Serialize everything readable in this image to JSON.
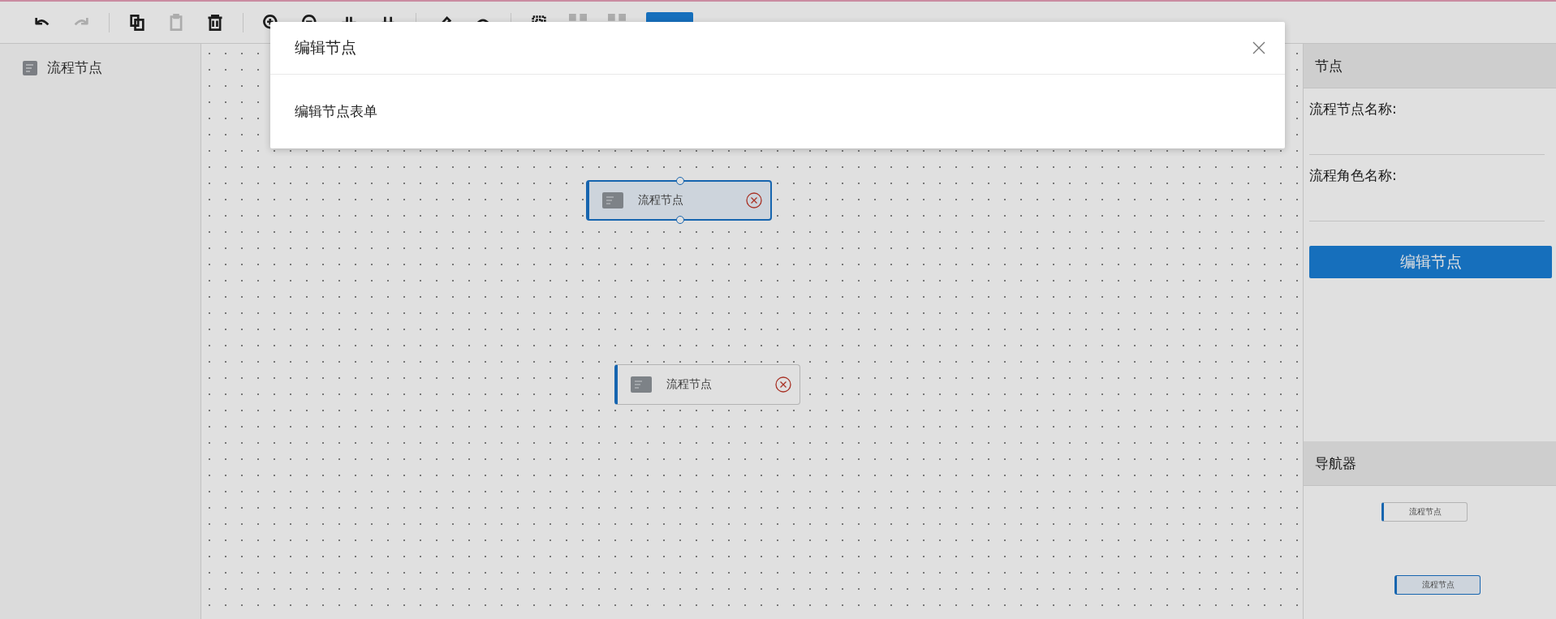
{
  "toolbar": {
    "items": [
      {
        "kind": "undo",
        "disabled": false
      },
      {
        "kind": "redo",
        "disabled": true
      },
      {
        "kind": "divider"
      },
      {
        "kind": "copy",
        "disabled": false
      },
      {
        "kind": "paste",
        "disabled": true
      },
      {
        "kind": "delete",
        "disabled": false
      },
      {
        "kind": "divider"
      },
      {
        "kind": "zoom-in",
        "disabled": false
      },
      {
        "kind": "zoom-out",
        "disabled": false
      },
      {
        "kind": "fit",
        "disabled": false
      },
      {
        "kind": "actual",
        "disabled": false
      },
      {
        "kind": "divider"
      },
      {
        "kind": "front",
        "disabled": false
      },
      {
        "kind": "back",
        "disabled": false
      },
      {
        "kind": "divider"
      },
      {
        "kind": "select",
        "disabled": false
      },
      {
        "kind": "group",
        "disabled": true
      },
      {
        "kind": "ungroup",
        "disabled": true
      }
    ]
  },
  "palette": {
    "items": [
      {
        "label": "流程节点"
      }
    ]
  },
  "canvas": {
    "nodes": [
      {
        "label": "流程节点",
        "selected": true
      },
      {
        "label": "流程节点",
        "selected": false
      }
    ]
  },
  "panel": {
    "title": "节点",
    "fields": [
      {
        "label": "流程节点名称:"
      },
      {
        "label": "流程角色名称:"
      }
    ],
    "button": "编辑节点"
  },
  "navigator": {
    "title": "导航器",
    "nodes": [
      {
        "label": "流程节点",
        "selected": false
      },
      {
        "label": "流程节点",
        "selected": true
      }
    ]
  },
  "modal": {
    "title": "编辑节点",
    "body": "编辑节点表单"
  }
}
